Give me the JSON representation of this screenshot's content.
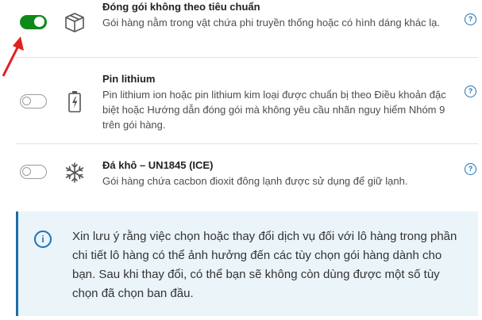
{
  "items": [
    {
      "title": "Đóng gói không theo tiêu chuẩn",
      "description": "Gói hàng nằm trong vật chứa phi truyền thống hoặc có hình dáng khác lạ.",
      "icon": "box-icon",
      "toggle_on": true
    },
    {
      "title": "Pin lithium",
      "description": "Pin lithium ion hoặc pin lithium kim loại được chuẩn bị theo Điều khoản đặc biệt hoặc Hướng dẫn đóng gói mà không yêu cầu nhãn nguy hiểm Nhóm 9 trên gói hàng.",
      "icon": "battery-icon",
      "toggle_on": false
    },
    {
      "title": "Đá khô – UN1845 (ICE)",
      "description": "Gói hàng chứa cacbon đioxit đông lạnh được sử dụng để giữ lạnh.",
      "icon": "snowflake-icon",
      "toggle_on": false
    }
  ],
  "help_glyph": "?",
  "info_note": {
    "icon_glyph": "i",
    "text": "Xin lưu ý rằng việc chọn hoặc thay đổi dịch vụ đối với lô hàng trong phần chi tiết lô hàng có thể ảnh hưởng đến các tùy chọn gói hàng dành cho bạn. Sau khi thay đổi, có thể bạn sẽ không còn dùng được một số tùy chọn đã chọn ban đầu."
  },
  "colors": {
    "toggle_on": "#0e8a18",
    "accent_blue": "#1a73b8",
    "note_background": "#eaf4f9",
    "arrow_red": "#e02020"
  }
}
